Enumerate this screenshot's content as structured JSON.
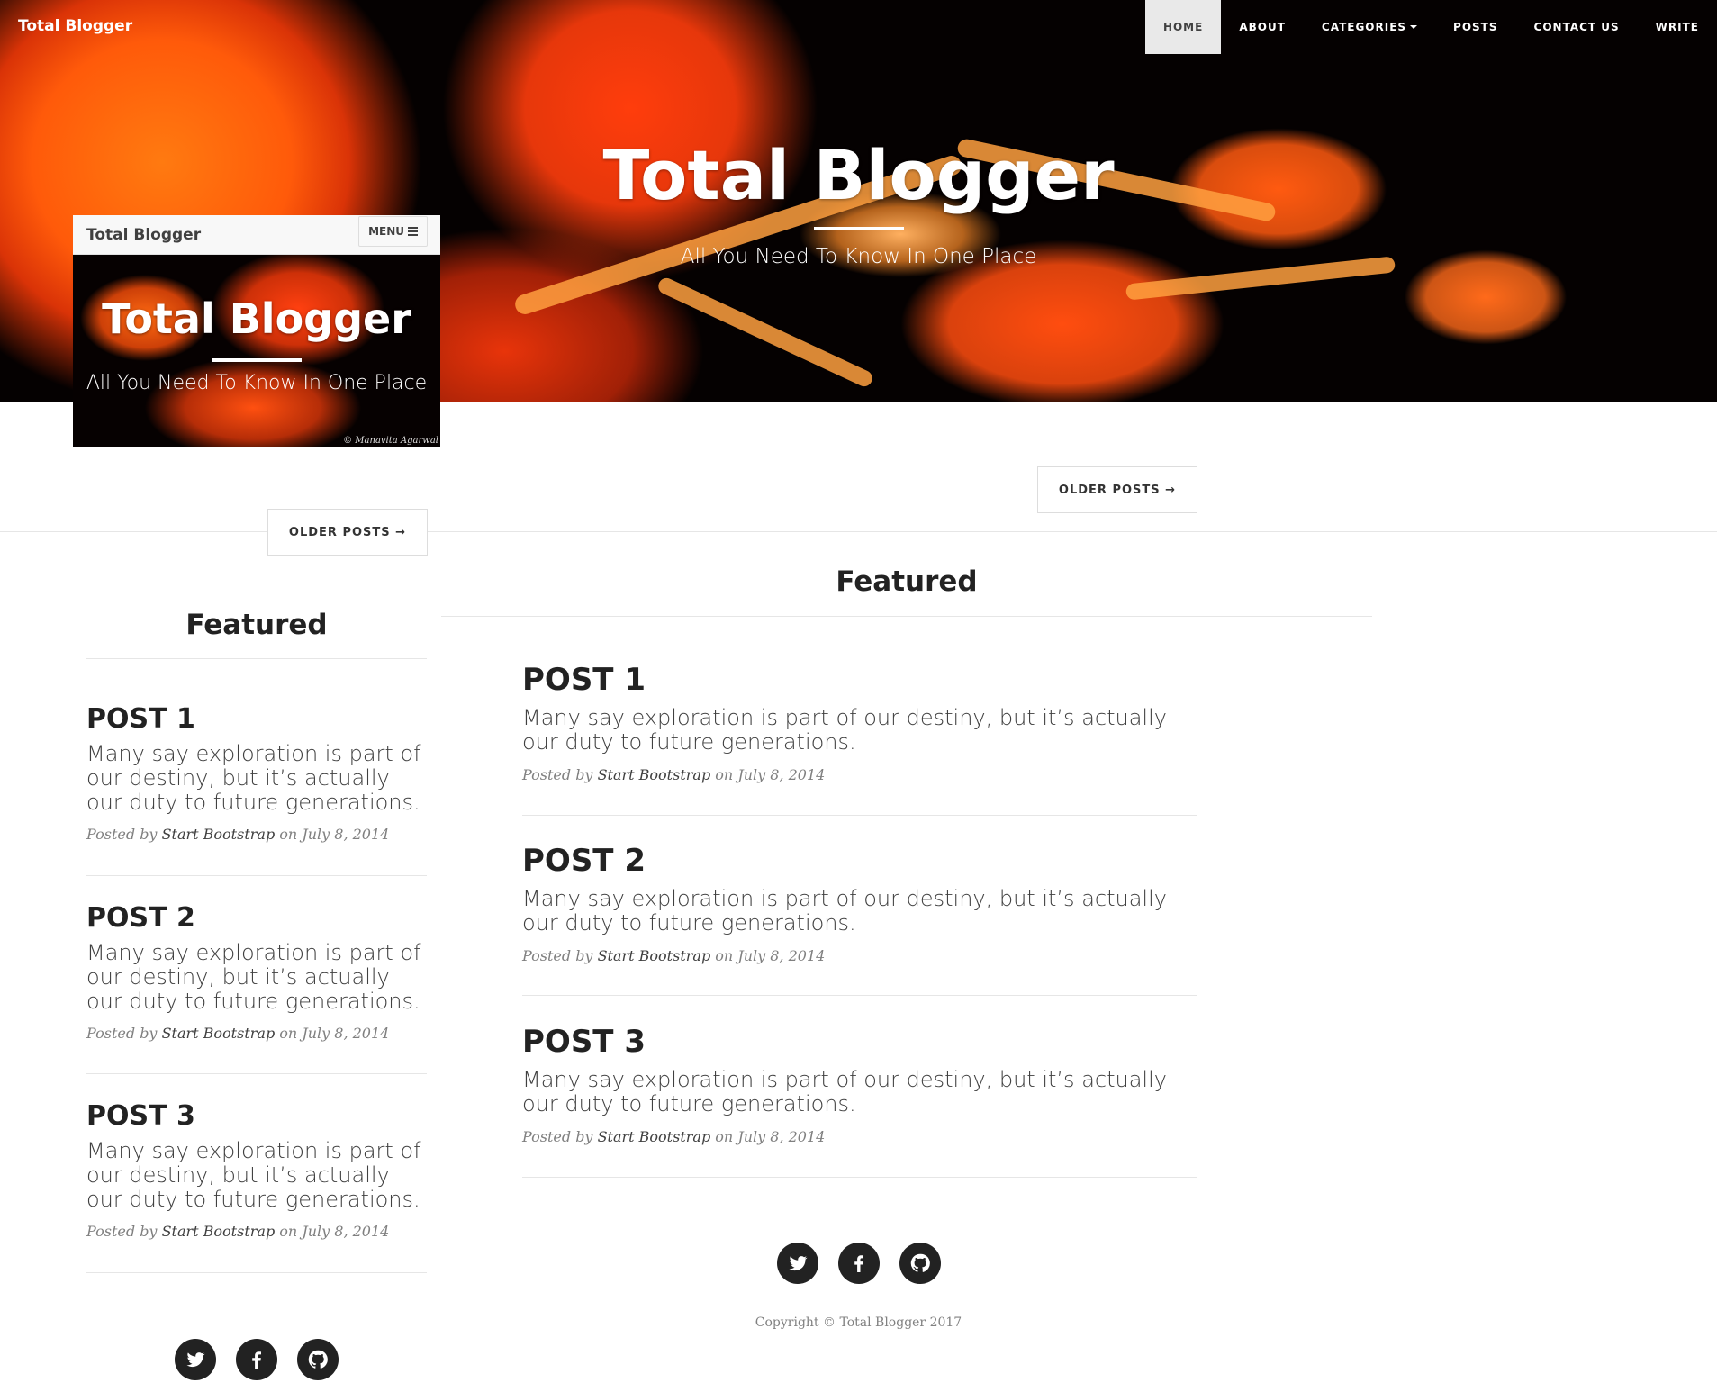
{
  "site": {
    "brand": "Total Blogger",
    "title": "Total Blogger",
    "subtitle": "All You Need To Know In One Place"
  },
  "nav": {
    "items": [
      {
        "label": "HOME",
        "active": true
      },
      {
        "label": "ABOUT"
      },
      {
        "label": "CATEGORIES",
        "dropdown": true
      },
      {
        "label": "POSTS"
      },
      {
        "label": "CONTACT US"
      },
      {
        "label": "WRITE"
      }
    ]
  },
  "pager": {
    "older_label": "OLDER POSTS →"
  },
  "featured": {
    "heading": "Featured"
  },
  "posts": [
    {
      "title": "POST 1",
      "excerpt": "Many say exploration is part of our destiny, but it’s actually our duty to future generations.",
      "meta_prefix": "Posted by",
      "author": "Start Bootstrap",
      "meta_on": "on",
      "date": "July 8, 2014"
    },
    {
      "title": "POST 2",
      "excerpt": "Many say exploration is part of our destiny, but it’s actually our duty to future generations.",
      "meta_prefix": "Posted by",
      "author": "Start Bootstrap",
      "meta_on": "on",
      "date": "July 8, 2014"
    },
    {
      "title": "POST 3",
      "excerpt": "Many say exploration is part of our destiny, but it’s actually our duty to future generations.",
      "meta_prefix": "Posted by",
      "author": "Start Bootstrap",
      "meta_on": "on",
      "date": "July 8, 2014"
    }
  ],
  "social": [
    {
      "icon": "twitter-icon"
    },
    {
      "icon": "facebook-icon"
    },
    {
      "icon": "github-icon"
    }
  ],
  "footer": {
    "copyright": "Copyright © Total Blogger 2017"
  },
  "mini": {
    "brand": "Total Blogger",
    "menu_label": "MENU",
    "title": "Total Blogger",
    "subtitle": "All You Need To Know In One Place",
    "photo_credit": "© Manavita Agarwal"
  },
  "colors": {
    "accent_orange": "#ff5a0a",
    "text_dark": "#222222",
    "meta_gray": "#808080",
    "nav_active_bg": "#e9e9e9"
  }
}
